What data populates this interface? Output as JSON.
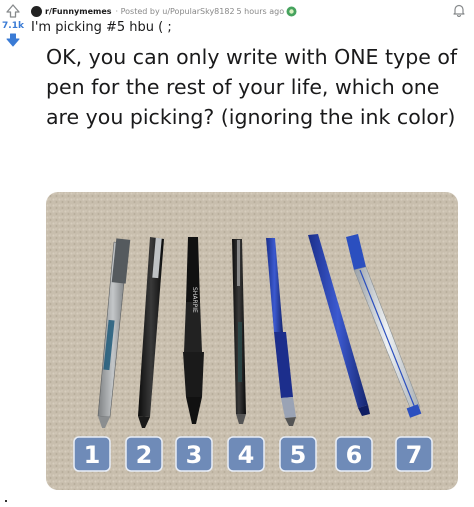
{
  "post": {
    "score": "7.1k",
    "subreddit": "r/Funnymemes",
    "posted_by": "· Posted by u/PopularSky8182",
    "time_ago": "5 hours ago",
    "title": "I'm picking #5 hbu ( ;"
  },
  "meme": {
    "caption": "OK, you can only write with ONE type of pen for the rest of your life, which one are you picking? (ignoring the ink color)"
  },
  "image": {
    "pens": [
      {
        "number": "1",
        "type": "silver-gel-pen"
      },
      {
        "number": "2",
        "type": "black-rollerball-pen"
      },
      {
        "number": "3",
        "type": "black-grip-pen"
      },
      {
        "number": "4",
        "type": "black-liquid-ink-pen"
      },
      {
        "number": "5",
        "type": "blue-pilot-g2-pen"
      },
      {
        "number": "6",
        "type": "navy-felt-tip-pen"
      },
      {
        "number": "7",
        "type": "clear-ballpoint-pen"
      }
    ]
  },
  "colors": {
    "badge_bg": "#6f8bb8",
    "carpet": "#c9bfae",
    "vote_blue": "#3a7bd5"
  }
}
